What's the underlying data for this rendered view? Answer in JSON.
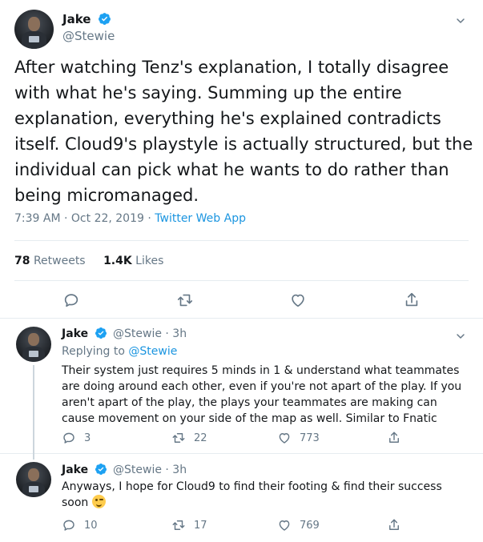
{
  "main_tweet": {
    "name": "Jake",
    "handle": "@Stewie",
    "text": "After watching Tenz's explanation, I totally disagree with what he's saying. Summing up the entire explanation, everything he's explained contradicts itself. Cloud9's playstyle is actually structured, but the individual can pick what he wants to do rather than being micromanaged.",
    "time": "7:39 AM",
    "date": "Oct 22, 2019",
    "separator": "·",
    "app": "Twitter Web App",
    "retweets_count": "78",
    "retweets_label": "Retweets",
    "likes_count": "1.4K",
    "likes_label": "Likes"
  },
  "replies": [
    {
      "name": "Jake",
      "handle": "@Stewie",
      "time": "· 3h",
      "replying_prefix": "Replying to",
      "replying_to": "@Stewie",
      "text": "Their system just requires 5 minds in 1 & understand what teammates are doing around each other, even if you're not apart of the play. If you aren't apart of the play, the plays your teammates are making can cause movement on your side of the map as well. Similar to Fnatic",
      "replies": "3",
      "retweets": "22",
      "likes": "773"
    },
    {
      "name": "Jake",
      "handle": "@Stewie",
      "time": "· 3h",
      "text": "Anyways, I hope for Cloud9 to find their footing & find their success soon",
      "emoji": "winking-face",
      "replies": "10",
      "retweets": "17",
      "likes": "769"
    }
  ],
  "colors": {
    "link": "#1b95e0",
    "secondary_text": "#657786",
    "icon": "#657786",
    "verified": "#1da1f2",
    "divider": "#e6ecf0"
  }
}
